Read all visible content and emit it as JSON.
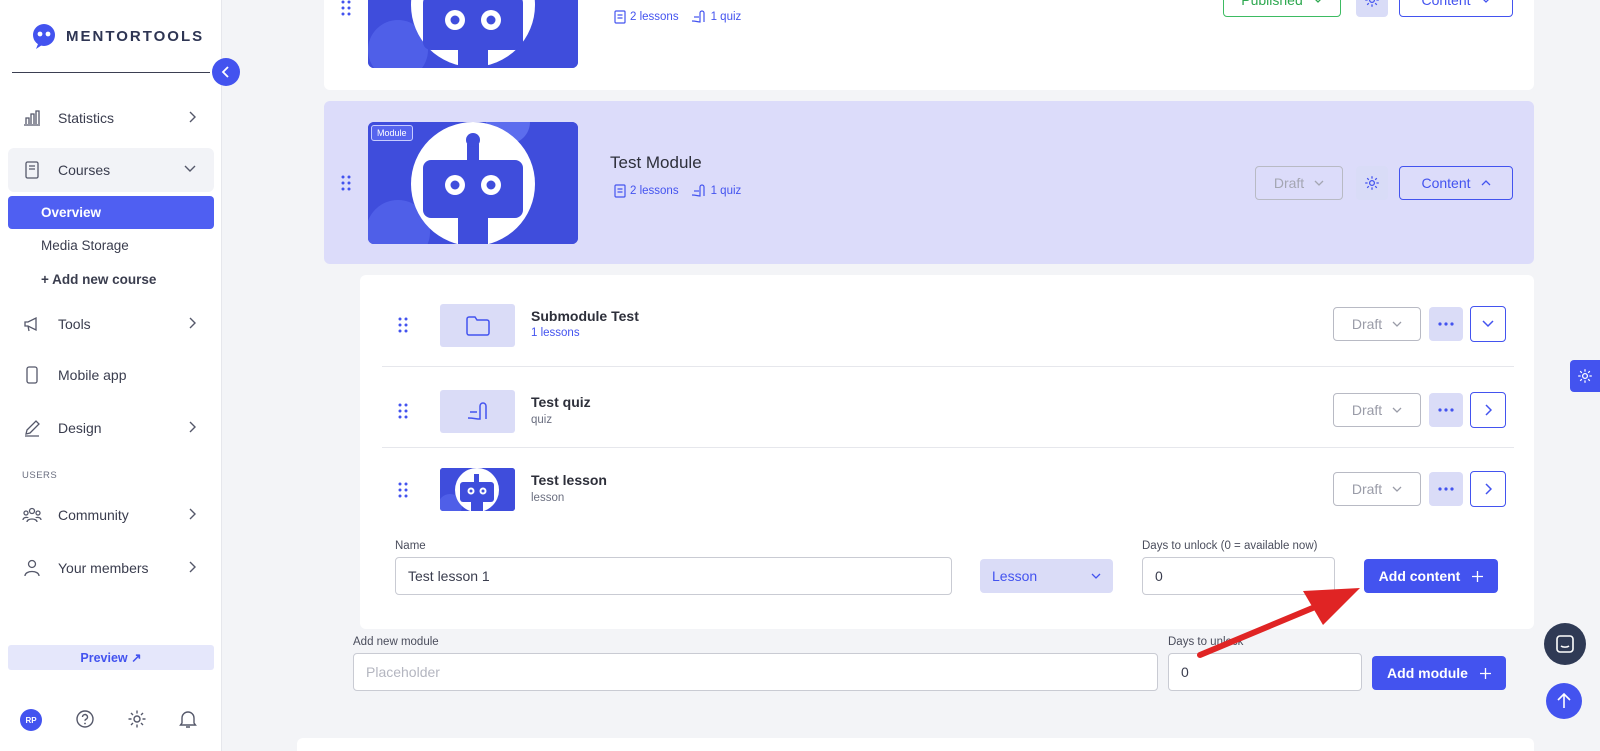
{
  "brand": {
    "name": "MENTORTOOLS"
  },
  "sidebar": {
    "items": [
      {
        "label": "Statistics",
        "icon": "bar-chart-icon"
      },
      {
        "label": "Courses",
        "icon": "book-icon"
      },
      {
        "label": "Tools",
        "icon": "megaphone-icon"
      },
      {
        "label": "Mobile app",
        "icon": "phone-icon"
      },
      {
        "label": "Design",
        "icon": "pencil-icon"
      },
      {
        "label": "Community",
        "icon": "people-icon"
      },
      {
        "label": "Your members",
        "icon": "user-icon"
      }
    ],
    "courses_sub": {
      "overview": "Overview",
      "media_storage": "Media Storage",
      "add_new_course": "+ Add new course"
    },
    "section_users": "USERS",
    "preview": "Preview ↗",
    "avatar_initials": "RP"
  },
  "top_module": {
    "lessons": "2 lessons",
    "quiz": "1 quiz",
    "status": "Published",
    "content_button": "Content"
  },
  "test_module": {
    "tag": "Module",
    "title": "Test Module",
    "lessons": "2 lessons",
    "quiz": "1 quiz",
    "status": "Draft",
    "content_button": "Content"
  },
  "content_rows": [
    {
      "title": "Submodule Test",
      "subtitle": "1 lessons",
      "status": "Draft",
      "icon": "folder-icon"
    },
    {
      "title": "Test quiz",
      "subtitle": "quiz",
      "status": "Draft",
      "icon": "quiz-icon"
    },
    {
      "title": "Test lesson",
      "subtitle": "lesson",
      "status": "Draft",
      "icon": "robot-thumbnail"
    }
  ],
  "add_content_form": {
    "name_label": "Name",
    "name_value": "Test lesson 1",
    "type_value": "Lesson",
    "days_label": "Days to unlock (0 = available now)",
    "days_value": "0",
    "submit": "Add content"
  },
  "add_module_form": {
    "label": "Add new module",
    "placeholder": "Placeholder",
    "days_label": "Days to unlock",
    "days_value": "0",
    "submit": "Add module"
  },
  "colors": {
    "accent": "#4353ef",
    "published": "#2ea850",
    "module_bg": "#dcdcfa",
    "annotation_arrow": "#e02424"
  }
}
